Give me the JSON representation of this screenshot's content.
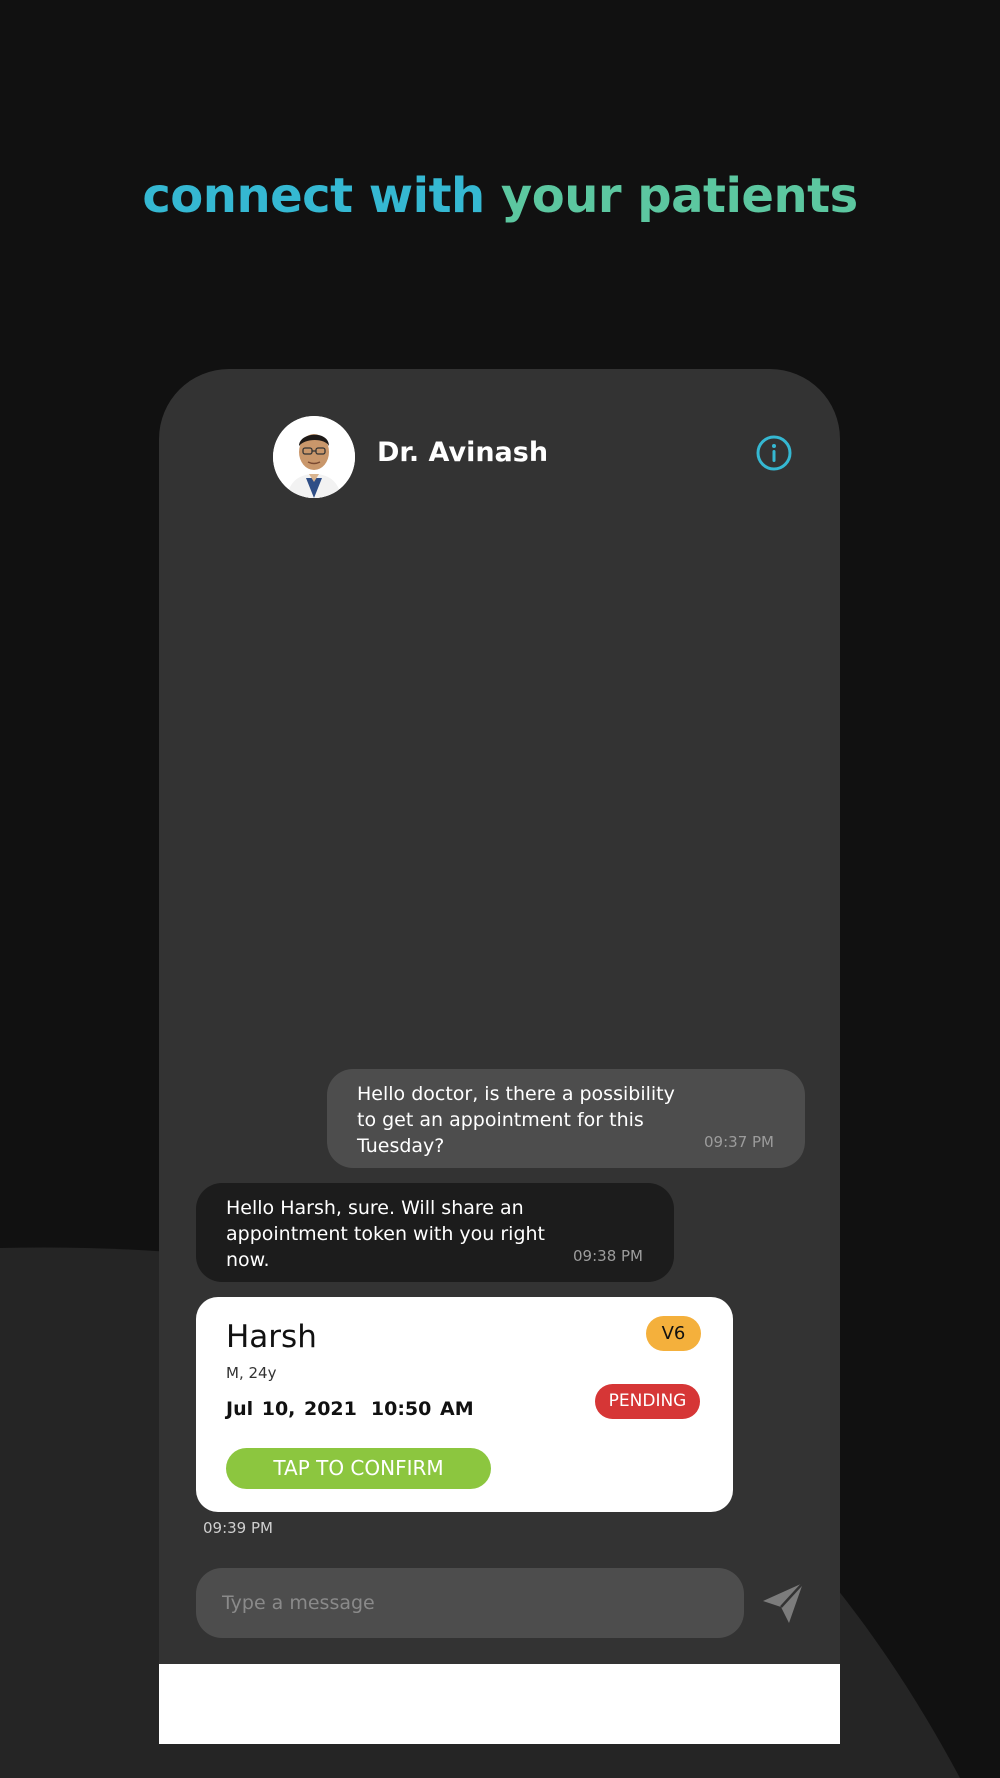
{
  "headline": {
    "part1": "connect with",
    "part2": "your patients",
    "color1": "#35b8d2",
    "color2": "#5cc7a0"
  },
  "chat_header": {
    "doctor_name": "Dr. Avinash",
    "avatar_icon": "doctor-avatar",
    "info_icon": "info-icon",
    "accent": "#35b8d2"
  },
  "messages": [
    {
      "direction": "outgoing",
      "text": "Hello doctor, is there a possibility\nto get an appointment for this\nTuesday?",
      "time": "09:37 PM"
    },
    {
      "direction": "incoming",
      "text": "Hello Harsh, sure. Will share an\nappointment token with you right\nnow.",
      "time": "09:38 PM"
    }
  ],
  "token_card": {
    "patient_name": "Harsh",
    "patient_meta": "M, 24y",
    "date": "Jul 10, 2021",
    "time": "10:50 AM",
    "version_badge": "V6",
    "status": "PENDING",
    "confirm_label": "TAP TO CONFIRM",
    "sent_time": "09:39 PM",
    "status_color": "#d63636",
    "version_color": "#f4b03c",
    "confirm_color": "#8cc63f"
  },
  "composer": {
    "placeholder": "Type a message",
    "send_icon": "send-icon"
  }
}
